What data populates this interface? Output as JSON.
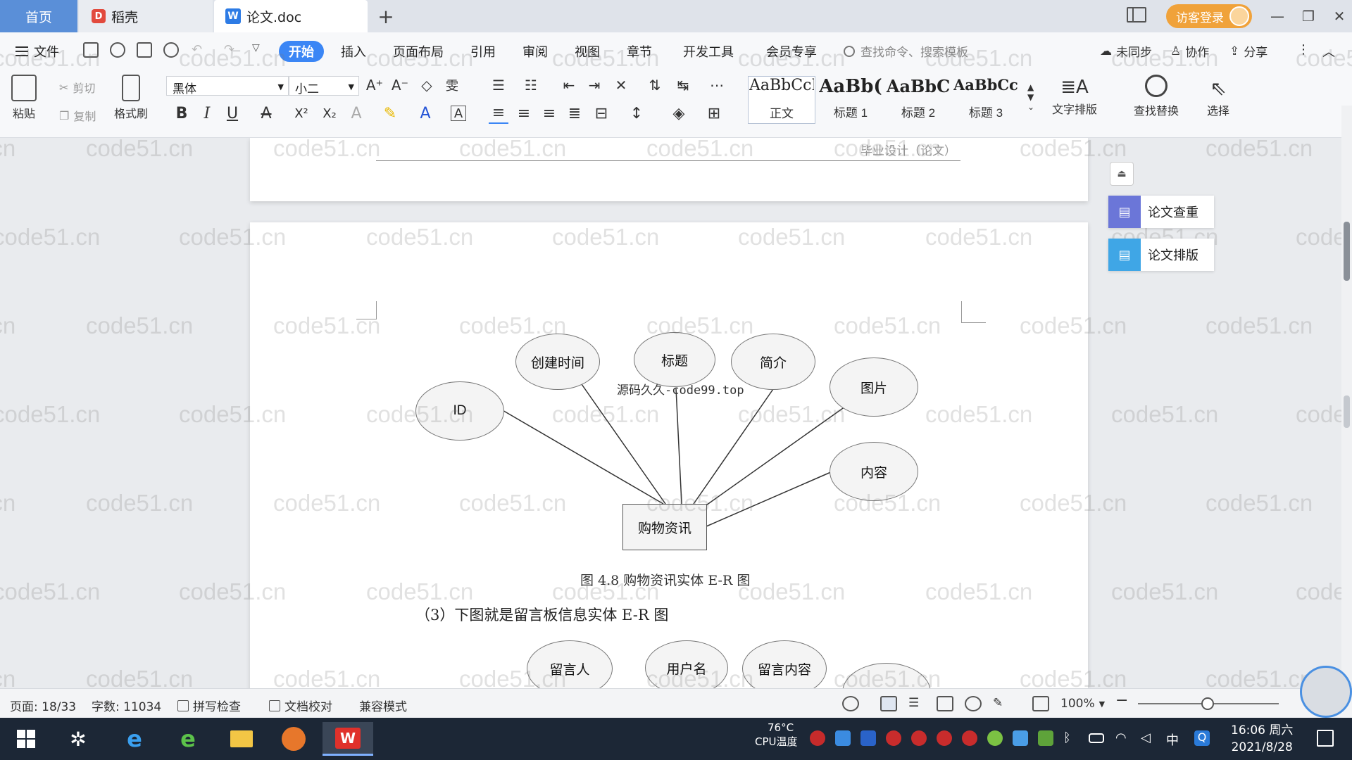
{
  "tabs": {
    "home": "首页",
    "daoke": "稻壳",
    "doc": "论文.doc"
  },
  "titlebar": {
    "login_label": "访客登录"
  },
  "menu": {
    "file": "文件",
    "items": [
      "开始",
      "插入",
      "页面布局",
      "引用",
      "审阅",
      "视图",
      "章节",
      "开发工具",
      "会员专享"
    ],
    "search_placeholder": "查找命令、搜索模板",
    "sync": "未同步",
    "collab": "协作",
    "share": "分享"
  },
  "ribbon": {
    "paste": "粘贴",
    "cut": "剪切",
    "copy": "复制",
    "format_painter": "格式刷",
    "font_name": "黑体",
    "font_size": "小二",
    "styles": [
      {
        "preview": "AaBbCcI",
        "label": "正文"
      },
      {
        "preview": "AaBb(",
        "label": "标题 1"
      },
      {
        "preview": "AaBbC",
        "label": "标题 2"
      },
      {
        "preview": "AaBbCcl",
        "label": "标题 3"
      }
    ],
    "text_layout": "文字排版",
    "find_replace": "查找替换",
    "select": "选择"
  },
  "document": {
    "header": "毕业设计（论文）",
    "stamp": "源码久久-code99.top",
    "entity": "购物资讯",
    "attributes": [
      "创建时间",
      "标题",
      "简介",
      "图片",
      "ID",
      "内容"
    ],
    "caption": "图 4.8  购物资讯实体 E-R 图",
    "paragraph": "（3）下图就是留言板信息实体 E-R 图",
    "next_attributes": [
      "留言人",
      "用户名",
      "留言内容"
    ]
  },
  "watermark": "code51.cn",
  "side_panel": {
    "check": "论文查重",
    "layout": "论文排版"
  },
  "status": {
    "page": "页面: 18/33",
    "words": "字数: 11034",
    "spell": "拼写检查",
    "proof": "文档校对",
    "compat": "兼容模式",
    "zoom": "100%"
  },
  "taskbar": {
    "temp": "76°C",
    "temp_label": "CPU温度",
    "ime": "中",
    "time": "16:06 周六",
    "date": "2021/8/28"
  },
  "colors": {
    "accent": "#3b86f5",
    "home_tab": "#5a8fd8",
    "login": "#f0a23a",
    "taskbar": "#1c2736"
  }
}
